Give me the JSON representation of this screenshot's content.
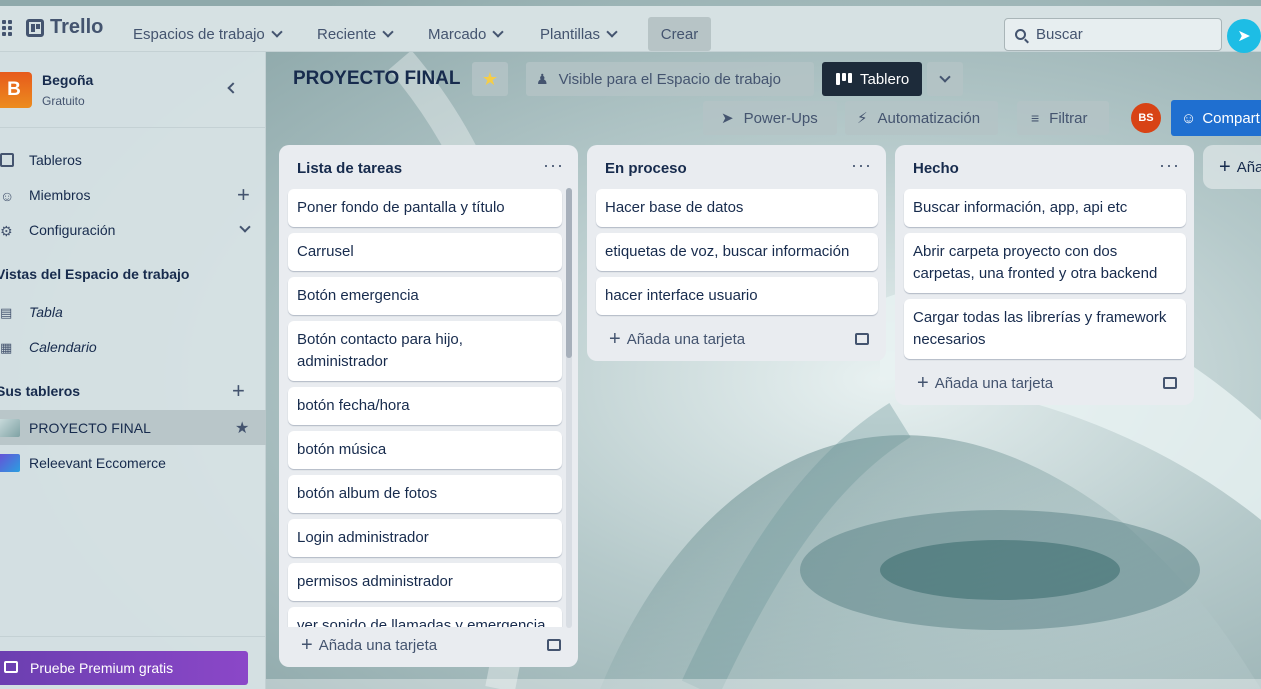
{
  "header": {
    "logo": "Trello",
    "nav": [
      {
        "label": "Espacios de trabajo"
      },
      {
        "label": "Reciente"
      },
      {
        "label": "Marcado"
      },
      {
        "label": "Plantillas"
      }
    ],
    "create": "Crear",
    "search_placeholder": "Buscar"
  },
  "sidebar": {
    "workspace_initial": "B",
    "workspace_name": "Begoña",
    "workspace_plan": "Gratuito",
    "items": [
      {
        "label": "Tableros"
      },
      {
        "label": "Miembros"
      },
      {
        "label": "Configuración"
      }
    ],
    "views_title": "Vistas del Espacio de trabajo",
    "views": [
      {
        "label": "Tabla"
      },
      {
        "label": "Calendario"
      }
    ],
    "boards_title": "Sus tableros",
    "boards": [
      {
        "label": "PROYECTO FINAL"
      },
      {
        "label": "Releevant Eccomerce"
      }
    ],
    "premium": "Pruebe Premium gratis"
  },
  "board": {
    "title": "PROYECTO FINAL",
    "visibility": "Visible para el Espacio de trabajo",
    "view": "Tablero",
    "powerups": "Power-Ups",
    "automation": "Automatización",
    "filter": "Filtrar",
    "member_initials": "BS",
    "share": "Compart",
    "add_list": "Aña"
  },
  "lists": [
    {
      "title": "Lista de tareas",
      "cards": [
        "Poner fondo de pantalla y título",
        "Carrusel",
        "Botón emergencia",
        "Botón contacto para hijo, administrador",
        "botón fecha/hora",
        "botón música",
        "botón album de fotos",
        "Login administrador",
        "permisos administrador",
        "ver sonido de llamadas y emergencia"
      ],
      "add_card": "Añada una tarjeta"
    },
    {
      "title": "En proceso",
      "cards": [
        "Hacer base de datos",
        "etiquetas de voz, buscar información",
        "hacer interface usuario"
      ],
      "add_card": "Añada una tarjeta"
    },
    {
      "title": "Hecho",
      "cards": [
        "Buscar información, app, api etc",
        "Abrir carpeta proyecto con dos carpetas, una fronted y otra backend",
        "Cargar todas las librerías y framework necesarios"
      ],
      "add_card": "Añada una tarjeta"
    }
  ],
  "colors": {
    "header_bg": "#d6e1e3",
    "sidebar_bg": "#d9e4e6",
    "list_bg": "#e9ecf0",
    "tablero_btn": "#1d2b3a",
    "share_btn": "#1f6fd0",
    "premium_btn": "#7e43c0",
    "workspace_avatar": "#e75a1c",
    "star": "#f5cd47"
  }
}
